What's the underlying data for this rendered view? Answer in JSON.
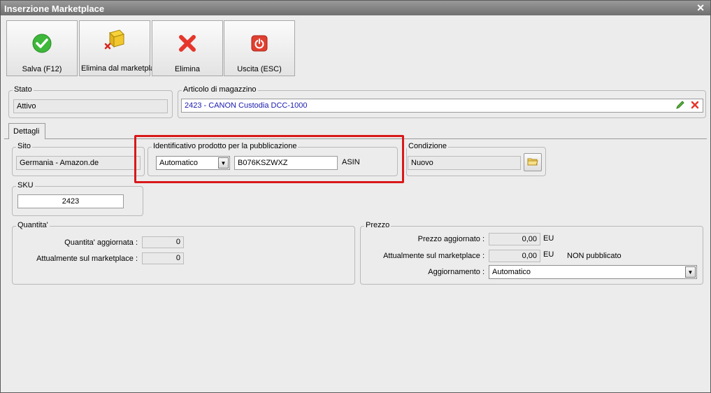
{
  "window": {
    "title": "Inserzione Marketplace",
    "close_icon": "close-icon"
  },
  "toolbar": {
    "save_label": "Salva (F12)",
    "remove_marketplace_label": "Elimina dal marketplace",
    "delete_label": "Elimina",
    "exit_label": "Uscita (ESC)"
  },
  "stato": {
    "label": "Stato",
    "value": "Attivo"
  },
  "articolo": {
    "label": "Articolo di magazzino",
    "value": "2423 - CANON Custodia DCC-1000",
    "value_color": "#1a1ab0"
  },
  "tabs": {
    "dettagli": "Dettagli"
  },
  "sito": {
    "label": "Sito",
    "value": "Germania - Amazon.de"
  },
  "identificativo": {
    "label": "Identificativo prodotto per la pubblicazione",
    "type_value": "Automatico",
    "code_value": "B076KSZWXZ",
    "suffix": "ASIN"
  },
  "condizione": {
    "label": "Condizione",
    "value": "Nuovo"
  },
  "sku": {
    "label": "SKU",
    "value": "2423"
  },
  "quantita": {
    "label": "Quantita'",
    "updated_label": "Quantita' aggiornata :",
    "updated_value": "0",
    "market_label": "Attualmente sul marketplace :",
    "market_value": "0"
  },
  "prezzo": {
    "label": "Prezzo",
    "updated_label": "Prezzo aggiornato :",
    "updated_value": "0,00",
    "updated_currency": "EU",
    "market_label": "Attualmente sul marketplace :",
    "market_value": "0,00",
    "market_currency": "EU",
    "market_status": "NON pubblicato",
    "update_label": "Aggiornamento :",
    "update_value": "Automatico"
  },
  "colors": {
    "highlight": "#d9181a",
    "save_green": "#3db83a",
    "delete_red": "#e6362b",
    "exit_red": "#e04030"
  }
}
